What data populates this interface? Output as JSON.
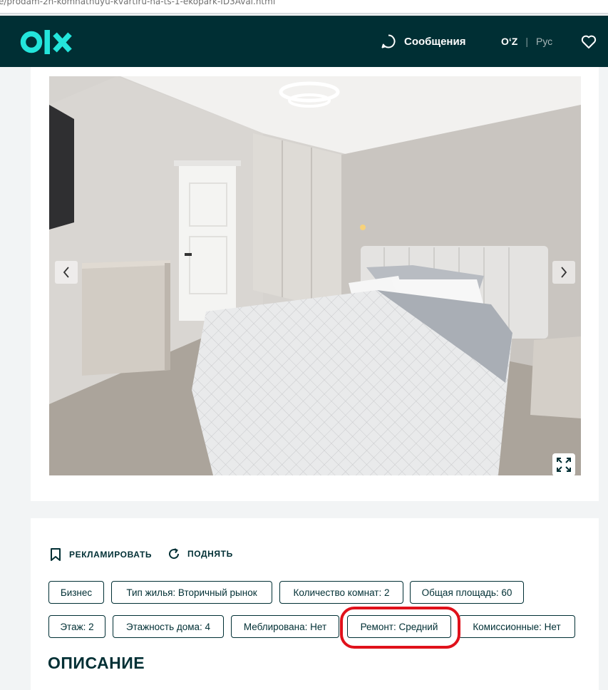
{
  "browser": {
    "url_fragment": "e/prodam-2h-komnatnuyu-kvartiru-na-ts-1-ekopark-ID3Aval.html"
  },
  "header": {
    "logo_alt": "olx",
    "messages_label": "Сообщения",
    "lang_active": "OʻZ",
    "lang_separator": "|",
    "lang_other": "Рус"
  },
  "actions": {
    "promote": "РЕКЛАМИРОВАТЬ",
    "raise": "ПОДНЯТЬ"
  },
  "tags": {
    "row1": [
      "Бизнес",
      "Тип жилья: Вторичный рынок",
      "Количество комнат: 2",
      "Общая площадь: 60"
    ],
    "row2": [
      "Этаж: 2",
      "Этажность дома: 4",
      "Меблирована: Нет",
      "Ремонт: Средний",
      "Комиссионные: Нет"
    ]
  },
  "description_title": "ОПИСАНИЕ",
  "colors": {
    "brand_dark": "#002f34",
    "brand_accent": "#23e5db",
    "highlight": "#e0111b"
  }
}
